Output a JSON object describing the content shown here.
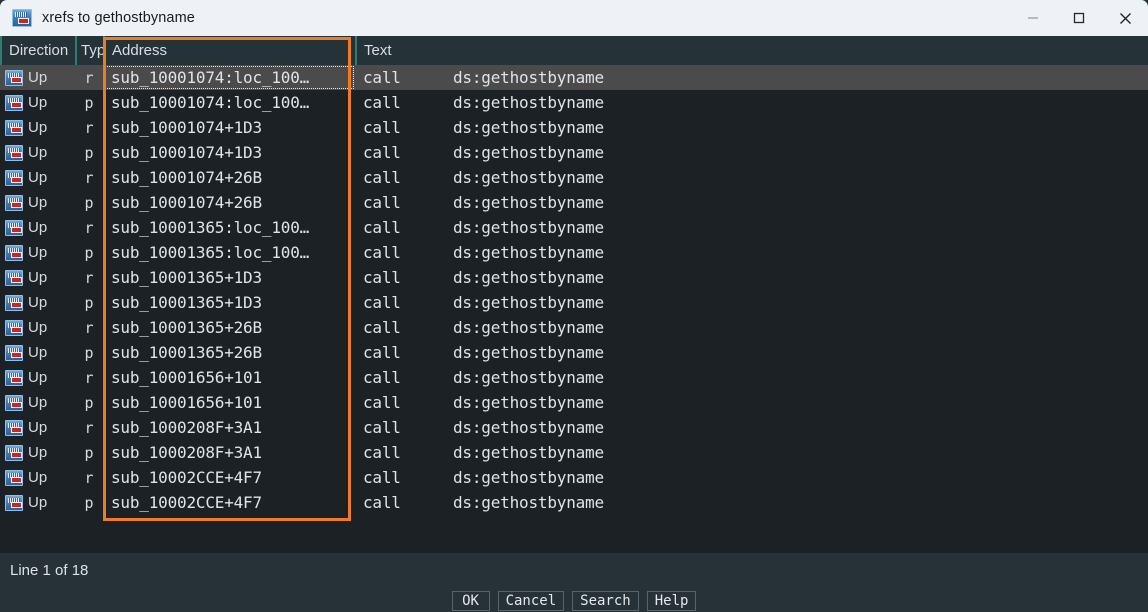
{
  "window": {
    "title": "xrefs to gethostbyname",
    "icon": "xref-window-icon",
    "controls": {
      "minimize": "minimize-icon",
      "maximize": "maximize-icon",
      "close": "close-icon"
    }
  },
  "colors": {
    "titlebar_bg": "#eef2f6",
    "header_bg": "#253238",
    "row_bg": "#1b2125",
    "row_selected_bg": "#4b4b4b",
    "panel_bg": "#263238",
    "highlight_border": "#f07c22",
    "column_separator": "#2e7d72",
    "text": "#dfe4e8"
  },
  "table": {
    "columns": [
      {
        "key": "direction",
        "label": "Direction"
      },
      {
        "key": "type",
        "label": "Typ"
      },
      {
        "key": "address",
        "label": "Address"
      },
      {
        "key": "text",
        "label": "Text"
      }
    ],
    "selected_index": 0,
    "rows": [
      {
        "icon": "xref-icon",
        "direction": "Up",
        "type": "r",
        "address": "sub_10001074:loc_100…",
        "mnemonic": "call",
        "operand": "ds:gethostbyname"
      },
      {
        "icon": "xref-icon",
        "direction": "Up",
        "type": "p",
        "address": "sub_10001074:loc_100…",
        "mnemonic": "call",
        "operand": "ds:gethostbyname"
      },
      {
        "icon": "xref-icon",
        "direction": "Up",
        "type": "r",
        "address": "sub_10001074+1D3",
        "mnemonic": "call",
        "operand": "ds:gethostbyname"
      },
      {
        "icon": "xref-icon",
        "direction": "Up",
        "type": "p",
        "address": "sub_10001074+1D3",
        "mnemonic": "call",
        "operand": "ds:gethostbyname"
      },
      {
        "icon": "xref-icon",
        "direction": "Up",
        "type": "r",
        "address": "sub_10001074+26B",
        "mnemonic": "call",
        "operand": "ds:gethostbyname"
      },
      {
        "icon": "xref-icon",
        "direction": "Up",
        "type": "p",
        "address": "sub_10001074+26B",
        "mnemonic": "call",
        "operand": "ds:gethostbyname"
      },
      {
        "icon": "xref-icon",
        "direction": "Up",
        "type": "r",
        "address": "sub_10001365:loc_100…",
        "mnemonic": "call",
        "operand": "ds:gethostbyname"
      },
      {
        "icon": "xref-icon",
        "direction": "Up",
        "type": "p",
        "address": "sub_10001365:loc_100…",
        "mnemonic": "call",
        "operand": "ds:gethostbyname"
      },
      {
        "icon": "xref-icon",
        "direction": "Up",
        "type": "r",
        "address": "sub_10001365+1D3",
        "mnemonic": "call",
        "operand": "ds:gethostbyname"
      },
      {
        "icon": "xref-icon",
        "direction": "Up",
        "type": "p",
        "address": "sub_10001365+1D3",
        "mnemonic": "call",
        "operand": "ds:gethostbyname"
      },
      {
        "icon": "xref-icon",
        "direction": "Up",
        "type": "r",
        "address": "sub_10001365+26B",
        "mnemonic": "call",
        "operand": "ds:gethostbyname"
      },
      {
        "icon": "xref-icon",
        "direction": "Up",
        "type": "p",
        "address": "sub_10001365+26B",
        "mnemonic": "call",
        "operand": "ds:gethostbyname"
      },
      {
        "icon": "xref-icon",
        "direction": "Up",
        "type": "r",
        "address": "sub_10001656+101",
        "mnemonic": "call",
        "operand": "ds:gethostbyname"
      },
      {
        "icon": "xref-icon",
        "direction": "Up",
        "type": "p",
        "address": "sub_10001656+101",
        "mnemonic": "call",
        "operand": "ds:gethostbyname"
      },
      {
        "icon": "xref-icon",
        "direction": "Up",
        "type": "r",
        "address": "sub_1000208F+3A1",
        "mnemonic": "call",
        "operand": "ds:gethostbyname"
      },
      {
        "icon": "xref-icon",
        "direction": "Up",
        "type": "p",
        "address": "sub_1000208F+3A1",
        "mnemonic": "call",
        "operand": "ds:gethostbyname"
      },
      {
        "icon": "xref-icon",
        "direction": "Up",
        "type": "r",
        "address": "sub_10002CCE+4F7",
        "mnemonic": "call",
        "operand": "ds:gethostbyname"
      },
      {
        "icon": "xref-icon",
        "direction": "Up",
        "type": "p",
        "address": "sub_10002CCE+4F7",
        "mnemonic": "call",
        "operand": "ds:gethostbyname"
      }
    ]
  },
  "status": {
    "line_info": "Line 1 of 18"
  },
  "buttons": [
    {
      "key": "ok",
      "label": "OK"
    },
    {
      "key": "cancel",
      "label": "Cancel"
    },
    {
      "key": "search",
      "label": "Search"
    },
    {
      "key": "help",
      "label": "Help"
    }
  ]
}
